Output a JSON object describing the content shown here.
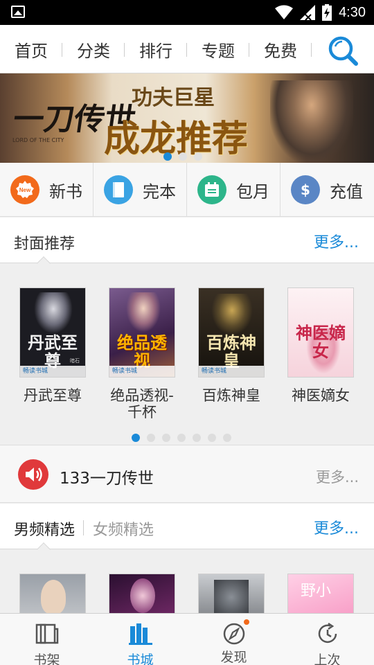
{
  "status_bar": {
    "time": "4:30"
  },
  "top_tabs": [
    {
      "label": "首页",
      "active": true
    },
    {
      "label": "分类",
      "active": false
    },
    {
      "label": "排行",
      "active": false
    },
    {
      "label": "专题",
      "active": false
    },
    {
      "label": "免费",
      "active": false
    }
  ],
  "banner": {
    "logo_text": "一刀传世",
    "logo_sub": "LORD OF THE CITY",
    "title_line1": "功夫巨星",
    "title_line2": "成龙推荐",
    "active_index": 0,
    "slide_count": 3
  },
  "quick_entries": [
    {
      "label": "新书",
      "icon": "new-badge-icon",
      "color": "#f26a1b",
      "glyph": "New"
    },
    {
      "label": "完本",
      "icon": "book-icon",
      "color": "#3aa3e3",
      "glyph": ""
    },
    {
      "label": "包月",
      "icon": "calendar-icon",
      "color": "#2db58a",
      "glyph": ""
    },
    {
      "label": "充值",
      "icon": "dollar-icon",
      "color": "#5a86c5",
      "glyph": "$"
    }
  ],
  "cover_section": {
    "title": "封面推荐",
    "more": "更多...",
    "books": [
      {
        "name": "丹武至尊",
        "cover_text": "丹武至尊",
        "author": "暗石",
        "tag": "畅读书城",
        "bg": "#1c1c22",
        "fg": "#f2f2f2"
      },
      {
        "name": "绝品透视-千杯",
        "cover_text": "绝品透视",
        "author": "",
        "tag": "畅读书城",
        "bg": "#5a3a6a",
        "fg": "#ffb400"
      },
      {
        "name": "百炼神皇",
        "cover_text": "百炼神皇",
        "author": "",
        "tag": "畅读书城",
        "bg": "#1e1a14",
        "fg": "#f5e6b0"
      },
      {
        "name": "神医嫡女",
        "cover_text": "神医嫡女",
        "author": "",
        "tag": "",
        "bg": "#fbe9ee",
        "fg": "#c8264a"
      }
    ],
    "pager_active": 0,
    "pager_count": 7
  },
  "notice": {
    "text": "133一刀传世",
    "more": "更多..."
  },
  "gender_section": {
    "tab_male": "男频精选",
    "tab_female": "女频精选",
    "more": "更多...",
    "covers": [
      {
        "bg": "#c9c9c9",
        "text": ""
      },
      {
        "bg": "#3a1a3a",
        "text": ""
      },
      {
        "bg": "#4a4a4a",
        "text": ""
      },
      {
        "bg": "#f4b7cf",
        "text": "野小"
      }
    ]
  },
  "bottom_nav": [
    {
      "label": "书架",
      "icon": "bookshelf-icon",
      "active": false
    },
    {
      "label": "书城",
      "icon": "bookstore-icon",
      "active": true
    },
    {
      "label": "发现",
      "icon": "compass-icon",
      "active": false
    },
    {
      "label": "上次",
      "icon": "history-icon",
      "active": false
    }
  ],
  "colors": {
    "accent": "#1a8ad8",
    "notice_red": "#e0393b",
    "badge_orange": "#f26a1b"
  }
}
